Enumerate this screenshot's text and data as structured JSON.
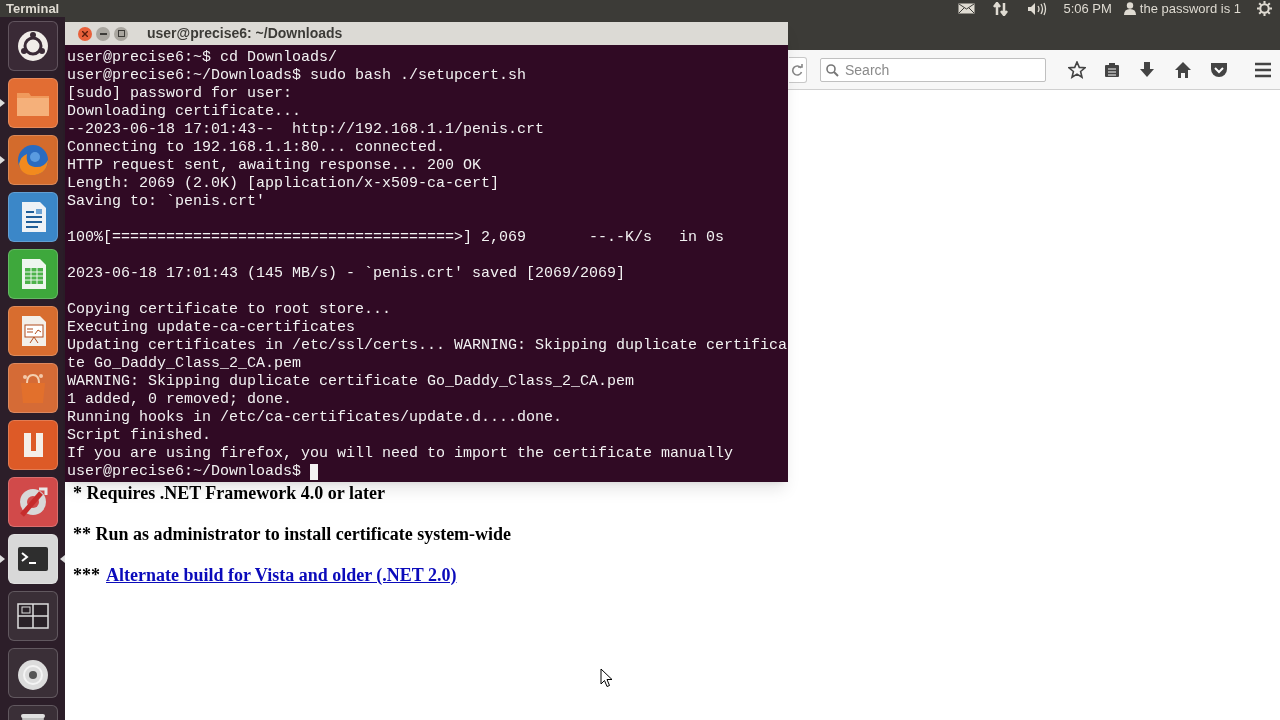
{
  "top_bar": {
    "app_title": "Terminal",
    "clock": "5:06 PM",
    "user": "the password is 1"
  },
  "launcher": [
    {
      "kind": "dash",
      "running": false,
      "focused": false
    },
    {
      "kind": "files",
      "running": true,
      "focused": false
    },
    {
      "kind": "browser",
      "running": true,
      "focused": false
    },
    {
      "kind": "writer",
      "running": false,
      "focused": false
    },
    {
      "kind": "calc",
      "running": false,
      "focused": false
    },
    {
      "kind": "impress",
      "running": false,
      "focused": false
    },
    {
      "kind": "software",
      "running": false,
      "focused": false
    },
    {
      "kind": "cloud",
      "running": false,
      "focused": false
    },
    {
      "kind": "settings",
      "running": false,
      "focused": false
    },
    {
      "kind": "terminal",
      "running": true,
      "focused": true
    },
    {
      "kind": "workspaces",
      "running": false,
      "focused": false
    },
    {
      "kind": "disc",
      "running": false,
      "focused": false
    },
    {
      "kind": "trash",
      "running": false,
      "focused": false
    }
  ],
  "terminal": {
    "title": "user@precise6: ~/Downloads",
    "blocks": [
      [
        "user@precise6:~$ cd Downloads/",
        "user@precise6:~/Downloads$ sudo bash ./setupcert.sh",
        "[sudo] password for user:",
        "Downloading certificate...",
        "--2023-06-18 17:01:43--  http://192.168.1.1/penis.crt",
        "Connecting to 192.168.1.1:80... connected.",
        "HTTP request sent, awaiting response... 200 OK",
        "Length: 2069 (2.0K) [application/x-x509-ca-cert]",
        "Saving to: `penis.crt'"
      ],
      [
        "100%[======================================>] 2,069       --.-K/s   in 0s"
      ],
      [
        "2023-06-18 17:01:43 (145 MB/s) - `penis.crt' saved [2069/2069]"
      ],
      [
        "Copying certificate to root store...",
        "Executing update-ca-certificates",
        "Updating certificates in /etc/ssl/certs... WARNING: Skipping duplicate certifica",
        "te Go_Daddy_Class_2_CA.pem",
        "WARNING: Skipping duplicate certificate Go_Daddy_Class_2_CA.pem",
        "1 added, 0 removed; done.",
        "Running hooks in /etc/ca-certificates/update.d....done.",
        "Script finished.",
        "If you are using firefox, you will need to import the certificate manually"
      ]
    ],
    "prompt": "user@precise6:~/Downloads$",
    "cursor": true
  },
  "browser": {
    "search": {
      "placeholder": "Search"
    },
    "page": [
      {
        "kind": "note",
        "text": "* Requires .NET Framework 4.0 or later"
      },
      {
        "kind": "note",
        "text": "** Run as administrator to install certificate system-wide"
      },
      {
        "kind": "link",
        "prefix": "***",
        "link": "Alternate build for Vista and older (.NET 2.0)"
      }
    ]
  }
}
